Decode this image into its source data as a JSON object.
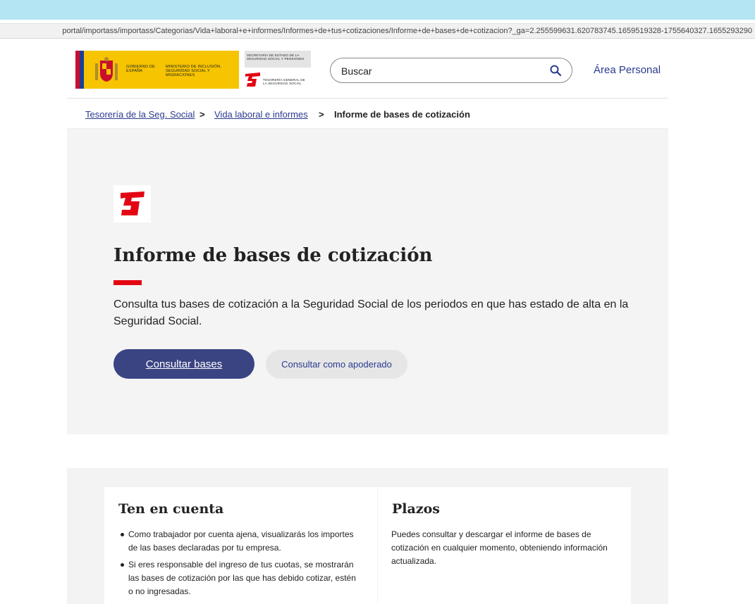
{
  "browser": {
    "url": "portal/importass/importass/Categorias/Vida+laboral+e+informes/Informes+de+tus+cotizaciones/Informe+de+bases+de+cotizacion?_ga=2.255599631.620783745.1659519328-1755640327.1655293290"
  },
  "header": {
    "logo": {
      "gobierno": "GOBIERNO DE ESPAÑA",
      "ministerio": "MINISTERIO DE INCLUSIÓN, SEGURIDAD SOCIAL Y MIGRACIONES",
      "secretaria": "SECRETARÍA DE ESTADO DE LA SEGURIDAD SOCIAL Y PENSIONES",
      "tesoreria": "TESORERÍA GENERAL DE LA SEGURIDAD SOCIAL"
    },
    "search_placeholder": "Buscar",
    "area_personal": "Área Personal"
  },
  "breadcrumb": {
    "items": [
      "Tesorería de la Seg. Social",
      "Vida laboral e informes"
    ],
    "separator": ">",
    "current": "Informe de bases de cotización"
  },
  "hero": {
    "title": "Informe de bases de cotización",
    "description": "Consulta tus bases de cotización a la Seguridad Social de los periodos en que has estado de alta en la Seguridad Social.",
    "primary_button": "Consultar bases",
    "secondary_button": "Consultar como apoderado"
  },
  "info": {
    "ten_en_cuenta": {
      "title": "Ten en cuenta",
      "items": [
        "Como trabajador por cuenta ajena, visualizarás los importes de las bases declaradas por tu empresa.",
        "Si eres responsable del ingreso de tus cuotas, se mostrarán las bases de cotización por las que has debido cotizar, estén o no ingresadas."
      ]
    },
    "plazos": {
      "title": "Plazos",
      "text": "Puedes consultar y descargar el informe de bases de cotización en cualquier momento, obteniendo información actualizada."
    }
  },
  "colors": {
    "brand_red": "#e30613",
    "primary_blue": "#3a4482",
    "link_blue": "#2a3a8f",
    "gov_yellow": "#f6c400"
  }
}
